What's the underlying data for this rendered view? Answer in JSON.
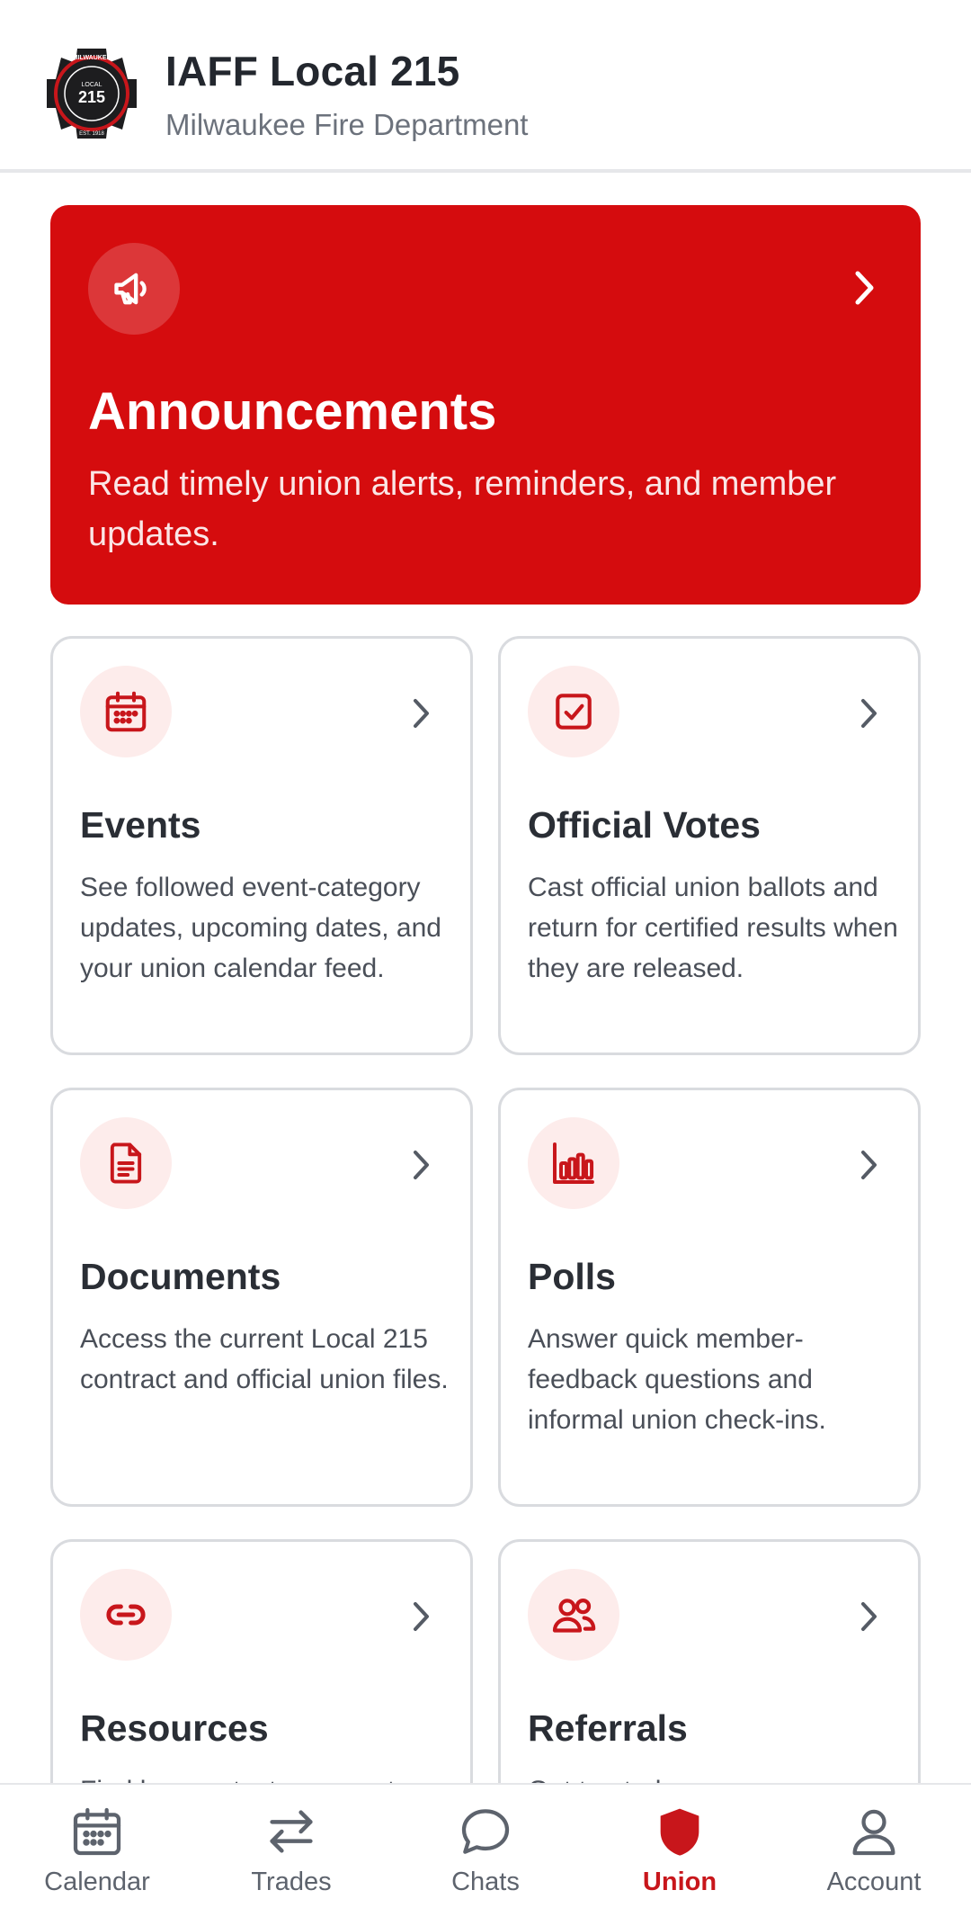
{
  "header": {
    "title": "IAFF Local 215",
    "subtitle": "Milwaukee Fire Department",
    "logo": {
      "top_text": "MILWAUKEE",
      "ring_text": "PROFESSIONAL FIREFIGHTERS",
      "local_label": "LOCAL",
      "number": "215",
      "est": "EST. 1918"
    }
  },
  "announcements": {
    "title": "Announcements",
    "description": "Read timely union alerts, reminders, and member updates.",
    "icon": "megaphone-icon"
  },
  "cards": [
    {
      "title": "Events",
      "description": "See followed event-category updates, upcoming dates, and your union calendar feed.",
      "icon": "calendar-icon"
    },
    {
      "title": "Official Votes",
      "description": "Cast official union ballots and return for certified results when they are released.",
      "icon": "checkbox-icon"
    },
    {
      "title": "Documents",
      "description": "Access the current Local 215 contract and official union files.",
      "icon": "document-icon"
    },
    {
      "title": "Polls",
      "description": "Answer quick member-feedback questions and informal union check-ins.",
      "icon": "bar-chart-icon"
    },
    {
      "title": "Resources",
      "description": "Find key contacts, support",
      "icon": "link-icon"
    },
    {
      "title": "Referrals",
      "description": "Get trusted",
      "icon": "users-icon"
    }
  ],
  "bottom_nav": {
    "active": "Union",
    "items": [
      {
        "label": "Calendar",
        "icon": "calendar-icon"
      },
      {
        "label": "Trades",
        "icon": "swap-arrows-icon"
      },
      {
        "label": "Chats",
        "icon": "chat-bubble-icon"
      },
      {
        "label": "Union",
        "icon": "shield-icon"
      },
      {
        "label": "Account",
        "icon": "person-icon"
      }
    ]
  },
  "colors": {
    "brand_red": "#d50c0e",
    "icon_red": "#c8161b",
    "icon_bg": "#fdeceb",
    "card_border": "#d9dbdf"
  }
}
